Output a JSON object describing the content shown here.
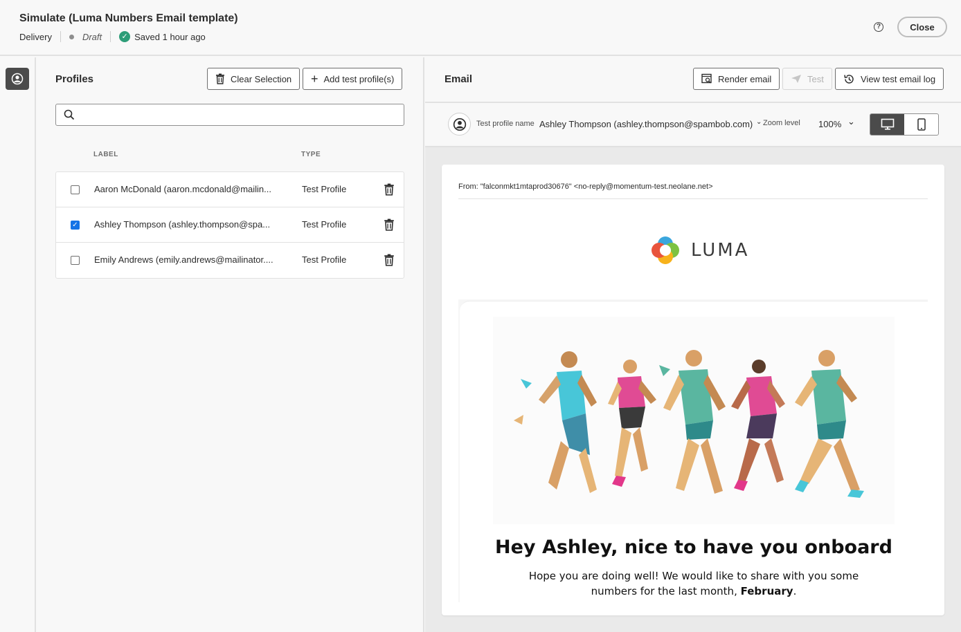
{
  "header": {
    "title": "Simulate (Luma Numbers Email template)",
    "channel": "Delivery",
    "status": "Draft",
    "saved": "Saved 1 hour ago",
    "close_label": "Close"
  },
  "profiles_panel": {
    "heading": "Profiles",
    "clear_selection_label": "Clear Selection",
    "add_profile_label": "Add test profile(s)",
    "search_value": "",
    "columns": {
      "label": "LABEL",
      "type": "TYPE"
    },
    "rows": [
      {
        "label": "Aaron McDonald (aaron.mcdonald@mailin...",
        "type": "Test Profile",
        "checked": false
      },
      {
        "label": "Ashley Thompson (ashley.thompson@spa...",
        "type": "Test Profile",
        "checked": true
      },
      {
        "label": "Emily Andrews (emily.andrews@mailinator....",
        "type": "Test Profile",
        "checked": false
      }
    ]
  },
  "email_panel": {
    "heading": "Email",
    "render_label": "Render email",
    "test_label": "Test",
    "log_label": "View test email log",
    "test_profile_label": "Test profile name",
    "test_profile_value": "Ashley Thompson (ashley.thompson@spambob.com)",
    "zoom_label": "Zoom level",
    "zoom_value": "100%",
    "from": "From: \"falconmkt1mtaprod30676\" <no-reply@momentum-test.neolane.net>",
    "logo_text": "LUMA",
    "greeting": "Hey Ashley, nice to have you onboard",
    "intro_text": "Hope you are doing well! We would like to share with you some numbers for the last month,",
    "intro_bold": "February",
    "intro_end": "."
  }
}
